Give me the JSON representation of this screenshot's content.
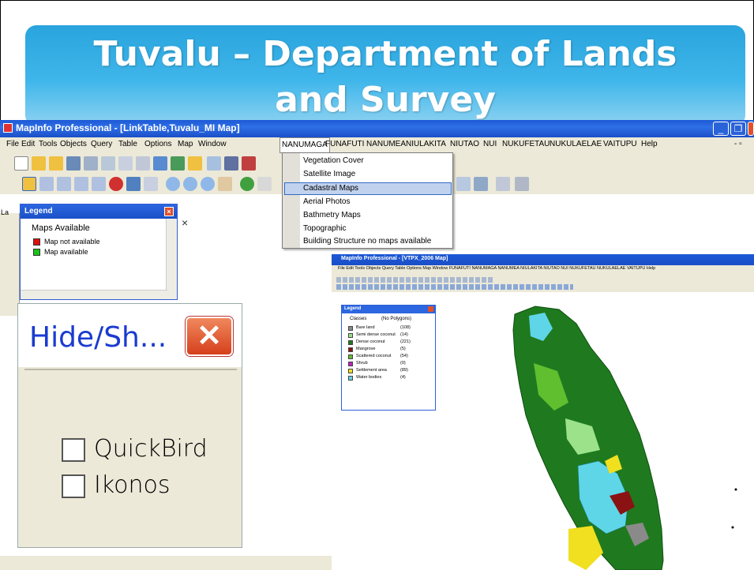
{
  "slide_title": "Tuvalu – Department of Lands and Survey",
  "window": {
    "title": "MapInfo Professional - [LinkTable,Tuvalu_MI Map]"
  },
  "menubar": [
    "File",
    "Edit",
    "Tools",
    "Objects",
    "Query",
    "Table",
    "Options",
    "Map",
    "Window",
    "NANUMAGA",
    "FUNAFUTI",
    "NANUMEA",
    "NIULAKITA",
    "NIUTAO",
    "NUI",
    "NUKUFETAU",
    "NUKULAELAE",
    "VAITUPU",
    "Help"
  ],
  "active_menu": "NANUMAGA",
  "dropdown": {
    "items": [
      "Vegetation Cover",
      "Satellite Image",
      "Cadastral Maps",
      "Aerial Photos",
      "Bathmetry Maps",
      "Topographic",
      "Building Structure no maps available"
    ],
    "highlighted": "Cadastral Maps"
  },
  "legend": {
    "title": "Legend",
    "heading": "Maps Available",
    "rows": [
      {
        "label": "Map not available",
        "color": "#e01010"
      },
      {
        "label": "Map available",
        "color": "#19c419"
      }
    ]
  },
  "hide_dialog": {
    "title": "Hide/Sh...",
    "options": [
      {
        "label": "QuickBird",
        "checked": false
      },
      {
        "label": "Ikonos",
        "checked": false
      }
    ]
  },
  "inset": {
    "window_title": "MapInfo Professional - [VTPX_2006 Map]",
    "menu_text": "File  Edit  Tools  Objects  Query  Table  Options  Map  Window  FUNAFUTI  NANUMAGA  NANUMEA  NIULAKITA  NIUTAO  NUI  NUKUFETAU  NUKULAELAE  VAITUPU  Help",
    "legend": {
      "title": "Legend",
      "classes_label": "Classes",
      "polygons_label": "(No Polygons)",
      "rows": [
        {
          "label": "Bare land",
          "count": "(108)",
          "color": "#8a8a8a"
        },
        {
          "label": "Semi dense coconut",
          "count": "(14)",
          "color": "#9be28a"
        },
        {
          "label": "Dense coconut",
          "count": "(221)",
          "color": "#1f7a1f"
        },
        {
          "label": "Mangrove",
          "count": "(5)",
          "color": "#8b1212"
        },
        {
          "label": "Scattered coconut",
          "count": "(54)",
          "color": "#5fbf2f"
        },
        {
          "label": "Shrub",
          "count": "(0)",
          "color": "#c020c0"
        },
        {
          "label": "Settlement area",
          "count": "(89)",
          "color": "#f0e020"
        },
        {
          "label": "Water bodies",
          "count": "(4)",
          "color": "#5fd5e8"
        }
      ]
    }
  }
}
